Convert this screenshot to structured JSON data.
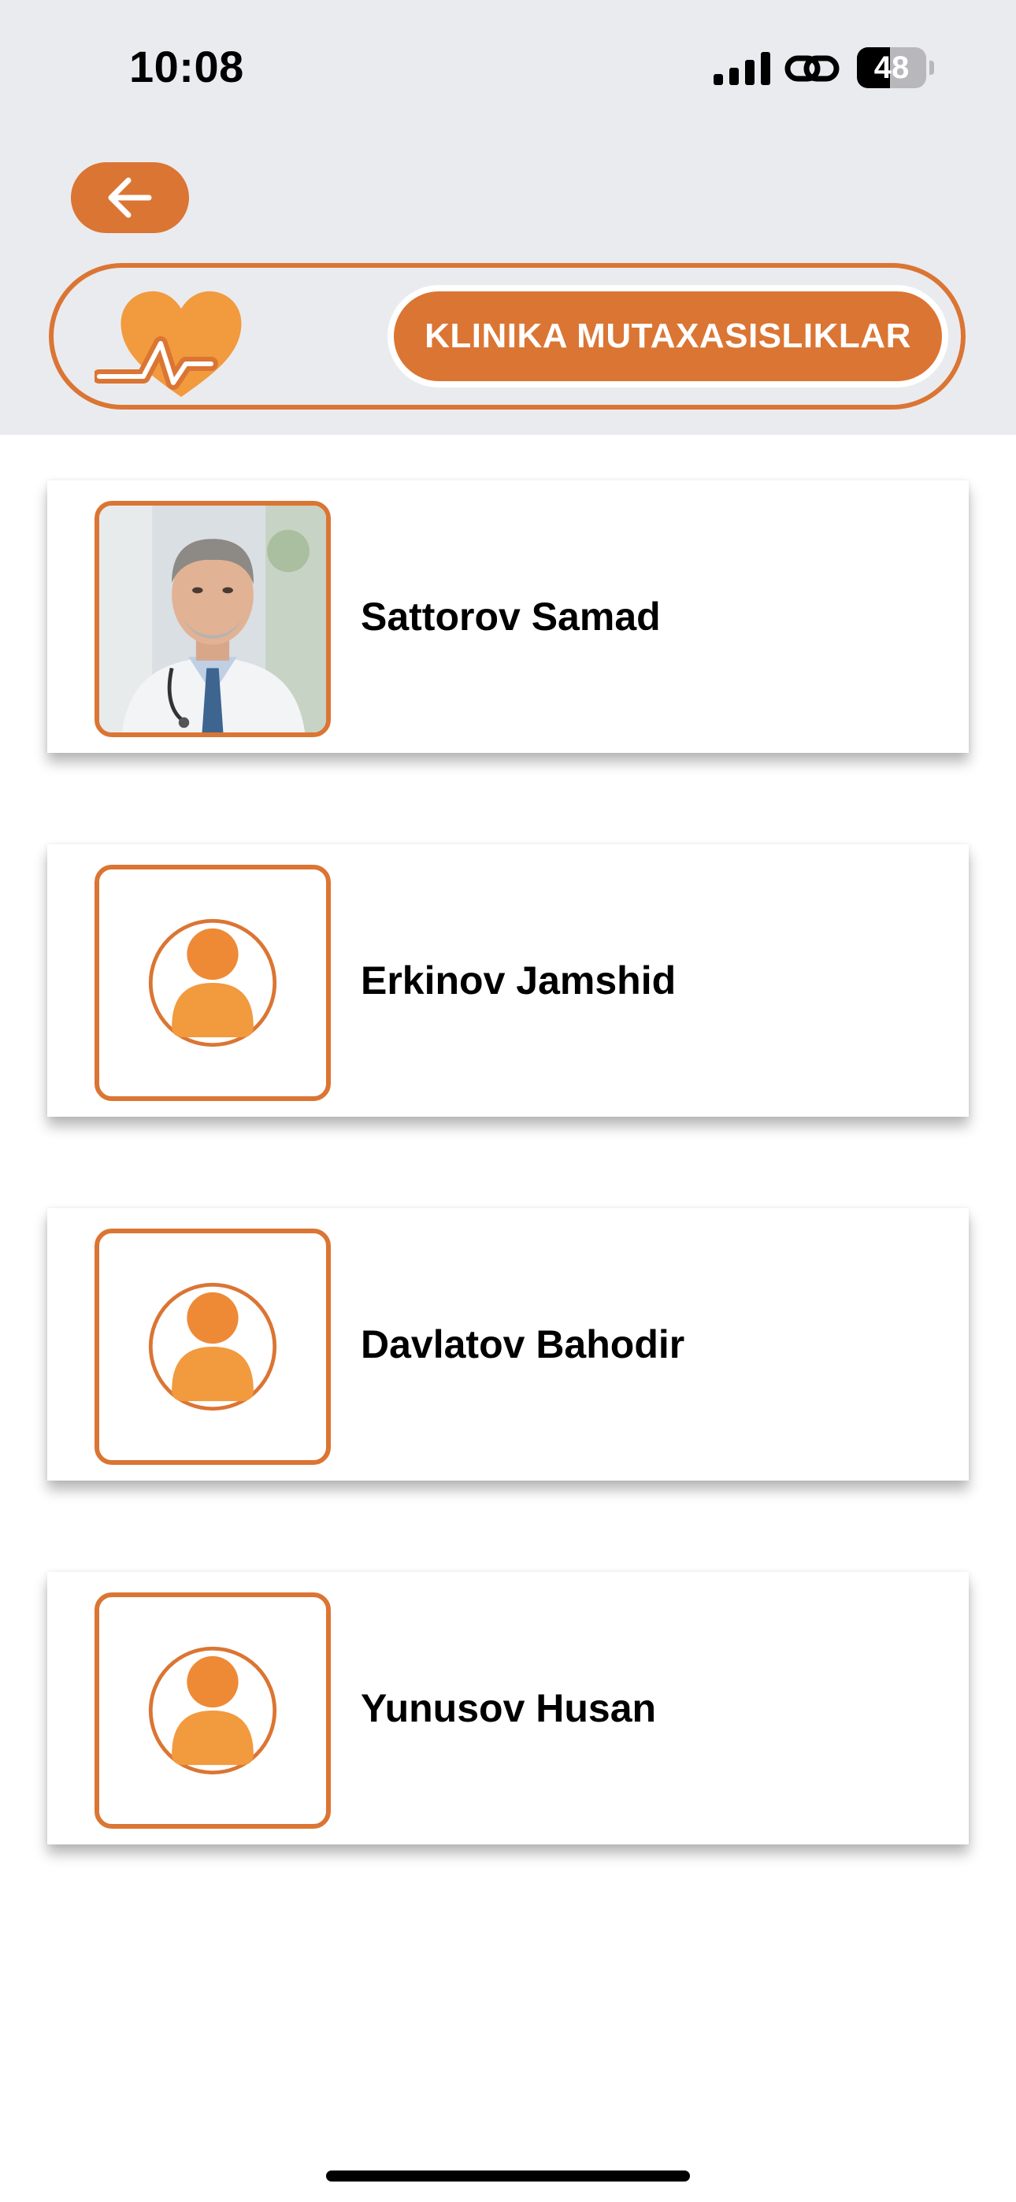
{
  "status_bar": {
    "time": "10:08",
    "battery_level": "48",
    "battery_fraction": 0.48,
    "icons": [
      "signal-icon",
      "link-icon",
      "battery-icon"
    ]
  },
  "header": {
    "back_icon": "arrow-left-icon",
    "logo_icon": "heart-pulse-icon",
    "title": "KLINIKA MUTAXASISLIKLAR"
  },
  "doctors": [
    {
      "name": "Sattorov Samad",
      "avatar": "doctor-photo"
    },
    {
      "name": "Erkinov Jamshid",
      "avatar": "user-placeholder-icon"
    },
    {
      "name": "Davlatov Bahodir",
      "avatar": "user-placeholder-icon"
    },
    {
      "name": "Yunusov Husan",
      "avatar": "user-placeholder-icon"
    }
  ],
  "colors": {
    "accent": "#db7533",
    "accent_light": "#f29a3e",
    "header_bg": "#eaebef",
    "background": "#ffffff",
    "text": "#000000"
  }
}
